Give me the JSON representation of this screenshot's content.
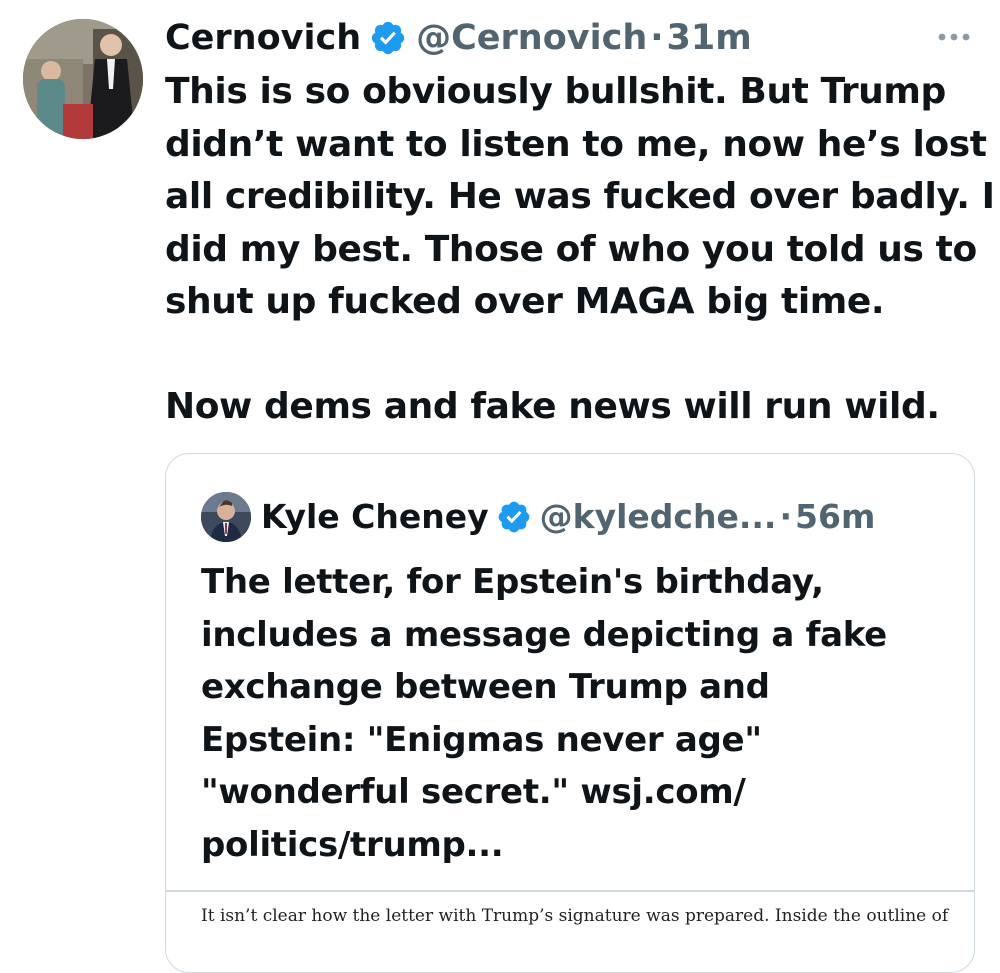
{
  "tweet": {
    "author": {
      "display_name": "Cernovich",
      "handle": "@Cernovich",
      "verified": true
    },
    "separator": "·",
    "timestamp": "31m",
    "text": "This is so obviously bullshit. But Trump\ndidn’t want to listen to me, now he’s lost\nall credibility. He was fucked over badly. I\ndid my best. Those of who you told us to\nshut up fucked over MAGA big time.\n\nNow dems and fake news will run wild.",
    "more_icon": "more-horizontal-icon"
  },
  "quoted": {
    "author": {
      "display_name": "Kyle Cheney",
      "handle": "@kyledche...",
      "verified": true
    },
    "separator": "·",
    "timestamp": "56m",
    "text": "The letter, for Epstein's birthday,\nincludes a message depicting a fake\nexchange between Trump and\nEpstein: \"Enigmas never age\"\n\"wonderful secret.\"  wsj.com/\npolitics/trump...",
    "image_text": "It isn’t clear how the letter with Trump’s signature was prepared. Inside the outline of"
  },
  "colors": {
    "text_primary": "#0f1419",
    "text_secondary": "#536471",
    "verified_blue": "#1d9bf0",
    "border": "#cfd9de"
  }
}
